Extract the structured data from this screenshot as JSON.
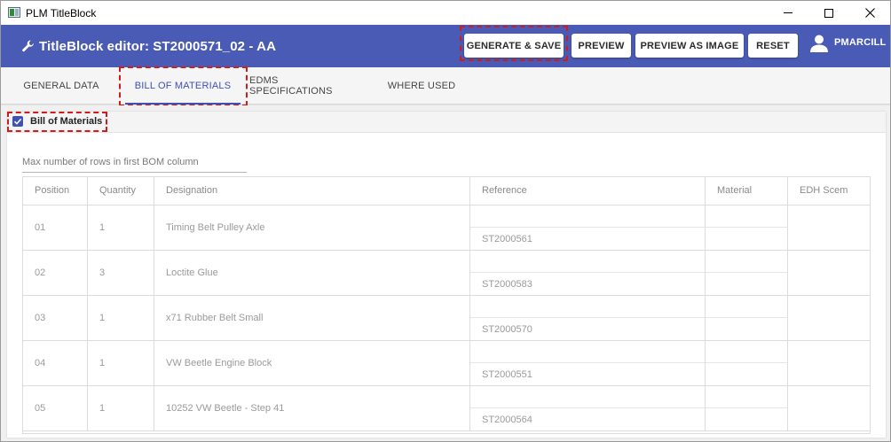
{
  "window": {
    "title": "PLM TitleBlock"
  },
  "appbar": {
    "title": "TitleBlock editor: ST2000571_02 - AA",
    "buttons": {
      "generate_save": "GENERATE & SAVE",
      "preview": "PREVIEW",
      "preview_image": "PREVIEW AS IMAGE",
      "reset": "RESET"
    },
    "user": "PMARCILL",
    "color": "#4a5bb6"
  },
  "tabs": {
    "general": "GENERAL DATA",
    "bom": "BILL OF MATERIALS",
    "edms": "EDMS SPECIFICATIONS",
    "where_used": "WHERE USED",
    "active": "BILL OF MATERIALS"
  },
  "bom_section": {
    "checkbox_label": "Bill of Materials",
    "checked": true,
    "max_rows_placeholder": "Max number of rows in first BOM column"
  },
  "table": {
    "headers": {
      "position": "Position",
      "quantity": "Quantity",
      "designation": "Designation",
      "reference": "Reference",
      "material": "Material",
      "edh": "EDH Scem"
    },
    "rows": [
      {
        "position": "01",
        "quantity": "1",
        "designation": "Timing Belt Pulley Axle",
        "reference": "ST2000561"
      },
      {
        "position": "02",
        "quantity": "3",
        "designation": "Loctite Glue",
        "reference": "ST2000583"
      },
      {
        "position": "03",
        "quantity": "1",
        "designation": "x71 Rubber Belt Small",
        "reference": "ST2000570"
      },
      {
        "position": "04",
        "quantity": "1",
        "designation": "VW Beetle Engine Block",
        "reference": "ST2000551"
      },
      {
        "position": "05",
        "quantity": "1",
        "designation": "10252 VW Beetle - Step 41",
        "reference": "ST2000564"
      }
    ]
  },
  "colors": {
    "accent": "#3f51b5",
    "highlight": "#d01c1c"
  }
}
